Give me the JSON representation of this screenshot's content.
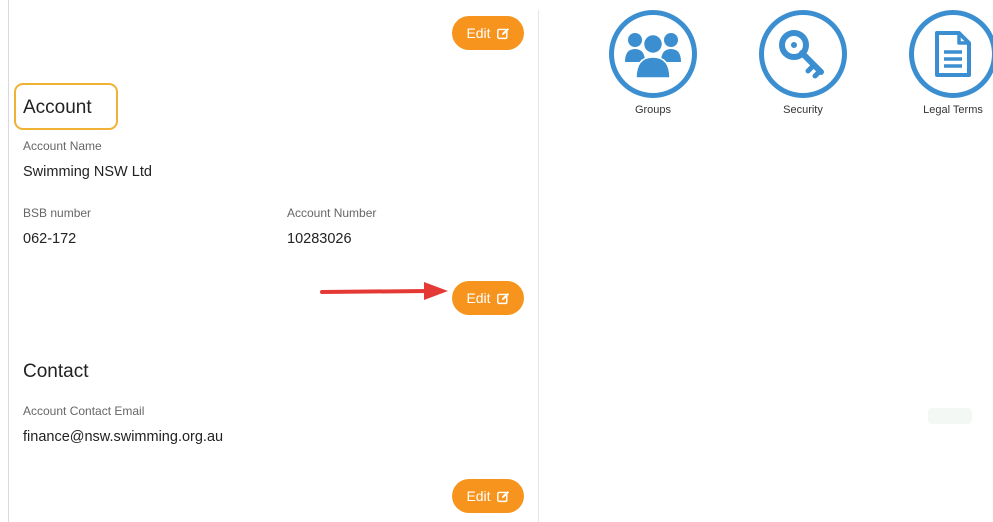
{
  "account": {
    "edit_top_label": "Edit",
    "title": "Account",
    "account_name_label": "Account Name",
    "account_name_value": "Swimming NSW Ltd",
    "bsb_label": "BSB number",
    "bsb_value": "062-172",
    "account_number_label": "Account Number",
    "account_number_value": "10283026",
    "edit_label": "Edit"
  },
  "contact": {
    "title": "Contact",
    "email_label": "Account Contact Email",
    "email_value": "finance@nsw.swimming.org.au",
    "edit_label": "Edit"
  },
  "tiles": [
    {
      "label": "Groups",
      "icon": "users-icon"
    },
    {
      "label": "Security",
      "icon": "key-icon"
    },
    {
      "label": "Legal Terms",
      "icon": "document-icon"
    }
  ],
  "colors": {
    "accent": "#f7941d",
    "tile_blue": "#3b8fd1",
    "highlight": "#f0b235",
    "arrow": "#e53935"
  }
}
